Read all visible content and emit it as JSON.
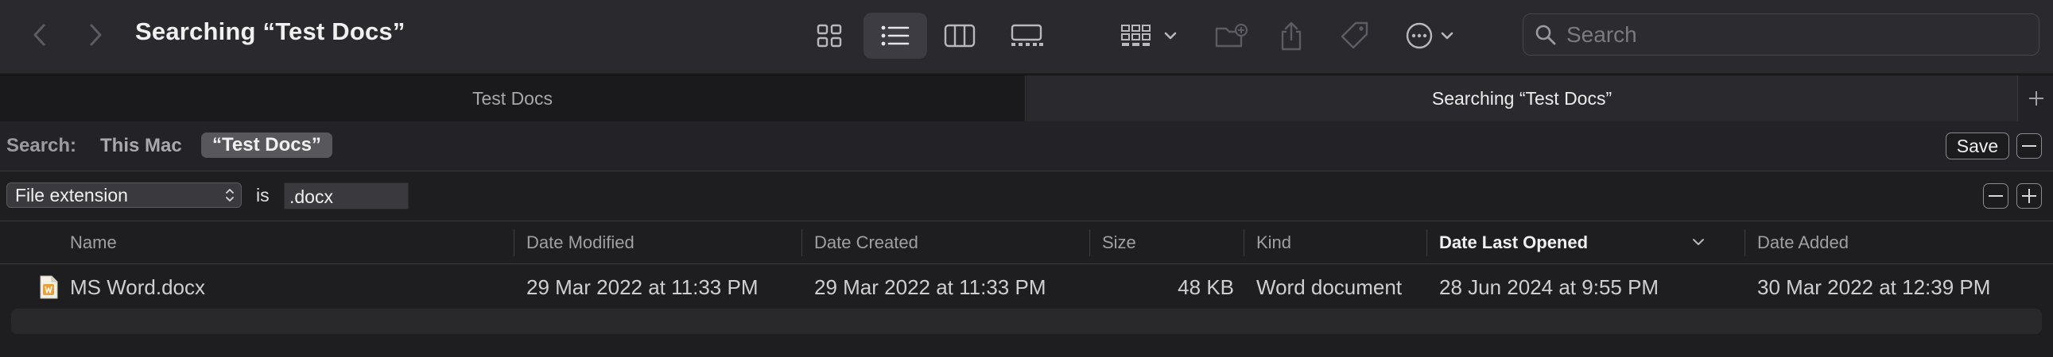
{
  "window": {
    "title": "Searching “Test Docs”",
    "icons": {
      "back": "chevron-left-icon",
      "forward": "chevron-right-icon",
      "icon_view": "grid-icon",
      "list_view": "list-icon",
      "column_view": "columns-icon",
      "gallery_view": "gallery-icon",
      "group": "group-icon",
      "new_folder": "new-folder-icon",
      "share": "share-icon",
      "tag": "tag-icon",
      "more": "ellipsis-circle-icon",
      "search": "magnifier-icon"
    }
  },
  "search": {
    "placeholder": "Search"
  },
  "tabs": [
    {
      "label": "Test Docs",
      "active": false
    },
    {
      "label": "Searching “Test Docs”",
      "active": true
    }
  ],
  "scope": {
    "label": "Search:",
    "options": [
      "This Mac",
      "“Test Docs”"
    ],
    "selected": "“Test Docs”",
    "save_label": "Save"
  },
  "criteria": {
    "attribute": "File extension",
    "operator": "is",
    "value": ".docx"
  },
  "columns": [
    {
      "label": "Name"
    },
    {
      "label": "Date Modified"
    },
    {
      "label": "Date Created"
    },
    {
      "label": "Size"
    },
    {
      "label": "Kind"
    },
    {
      "label": "Date Last Opened",
      "sorted": true
    },
    {
      "label": "Date Added"
    }
  ],
  "files": [
    {
      "name": "MS Word.docx",
      "date_modified": "29 Mar 2022 at 11:33 PM",
      "date_created": "29 Mar 2022 at 11:33 PM",
      "size": "48 KB",
      "kind": "Word document",
      "date_last_opened": "28 Jun 2024 at 9:55 PM",
      "date_added": "30 Mar 2022 at 12:39 PM"
    }
  ],
  "colors": {
    "toolbar_bg": "#2a292e",
    "window_bg": "#1e1e20",
    "doc_icon_accent": "#e9a23b"
  }
}
